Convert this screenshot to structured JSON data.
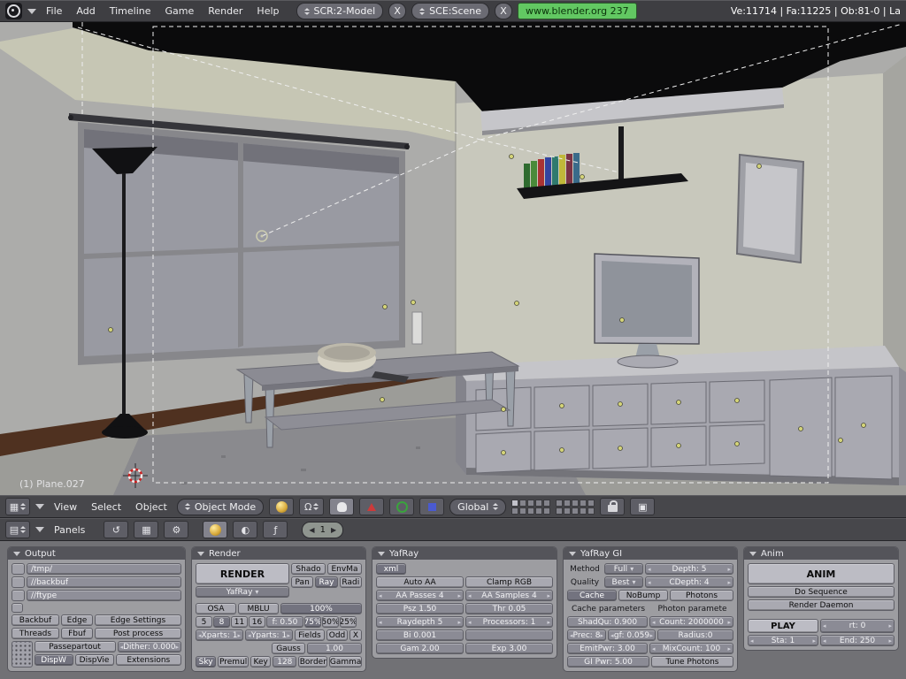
{
  "topbar": {
    "menus": [
      "File",
      "Add",
      "Timeline",
      "Game",
      "Render",
      "Help"
    ],
    "screen": "SCR:2-Model",
    "scene": "SCE:Scene",
    "close": "X",
    "version": "www.blender.org 237",
    "stats": "Ve:11714 | Fa:11225 | Ob:81-0 | La"
  },
  "viewport": {
    "object_label": "(1) Plane.027"
  },
  "view_header": {
    "menus": [
      "View",
      "Select",
      "Object"
    ],
    "mode": "Object Mode",
    "pivot_glyph": "Ω",
    "orientation": "Global"
  },
  "buttons_header": {
    "panels": "Panels",
    "frame": "1"
  },
  "output": {
    "title": "Output",
    "path1": "/tmp/",
    "path2": "//backbuf",
    "path3": "//ftype",
    "backbuf": "Backbuf",
    "edge": "Edge",
    "edge_settings": "Edge Settings",
    "threads": "Threads",
    "fbuf": "Fbuf",
    "post_process": "Post process",
    "passepartout": "Passepartout",
    "dither": "Dither: 0.000",
    "dispw": "DispW",
    "dispview": "DispVie",
    "extensions": "Extensions"
  },
  "render": {
    "title": "Render",
    "render": "RENDER",
    "engine": "YafRay",
    "shado": "Shado",
    "envma": "EnvMa",
    "pan": "Pan",
    "ray": "Ray",
    "radi": "Radi",
    "osa": "OSA",
    "mblu": "MBLU",
    "p100": "100%",
    "s5": "5",
    "s8": "8",
    "s11": "11",
    "s16": "16",
    "f": "f: 0.50",
    "p75": "75%",
    "p50": "50%",
    "p25": "25%",
    "xparts": "Xparts: 1",
    "yparts": "Yparts: 1",
    "fields": "Fields",
    "odd": "Odd",
    "x": "X",
    "gauss": "Gauss",
    "gval": "1.00",
    "sky": "Sky",
    "premul": "Premul",
    "key": "Key",
    "v128": "128",
    "border": "Border",
    "gamma": "Gamma"
  },
  "yafray": {
    "title": "YafRay",
    "xml": "xml",
    "auto_aa": "Auto AA",
    "clamp": "Clamp RGB",
    "aa_passes": "AA Passes 4",
    "aa_samples": "AA Samples 4",
    "psz": "Psz 1.50",
    "thr": "Thr 0.05",
    "raydepth": "Raydepth 5",
    "procs": "Processors: 1",
    "bi": "Bi 0.001",
    "gam": "Gam 2.00",
    "exp": "Exp 3.00"
  },
  "gi": {
    "title": "YafRay GI",
    "method_lbl": "Method",
    "method": "Full",
    "depth": "Depth: 5",
    "quality_lbl": "Quality",
    "quality": "Best",
    "cdepth": "CDepth: 4",
    "cache": "Cache",
    "nobump": "NoBump",
    "photons": "Photons",
    "cache_params": "Cache parameters",
    "photon_params": "Photon paramete",
    "shadqu": "ShadQu: 0.900",
    "count": "Count: 2000000",
    "prec": "Prec: 8",
    "gf": "gf: 0.059",
    "radius": "Radius:0",
    "emitpwr": "EmitPwr: 3.00",
    "mixcount": "MixCount: 100",
    "gipwr": "GI Pwr: 5.00",
    "tune": "Tune Photons"
  },
  "anim": {
    "title": "Anim",
    "anim": "ANIM",
    "do_sequence": "Do Sequence",
    "daemon": "Render Daemon",
    "play": "PLAY",
    "rt": "rt: 0",
    "sta": "Sta: 1",
    "end": "End: 250"
  },
  "colors": {
    "version_bg": "#62c862",
    "object_dot": "#d4d478",
    "cursor_red": "#cc2222"
  }
}
